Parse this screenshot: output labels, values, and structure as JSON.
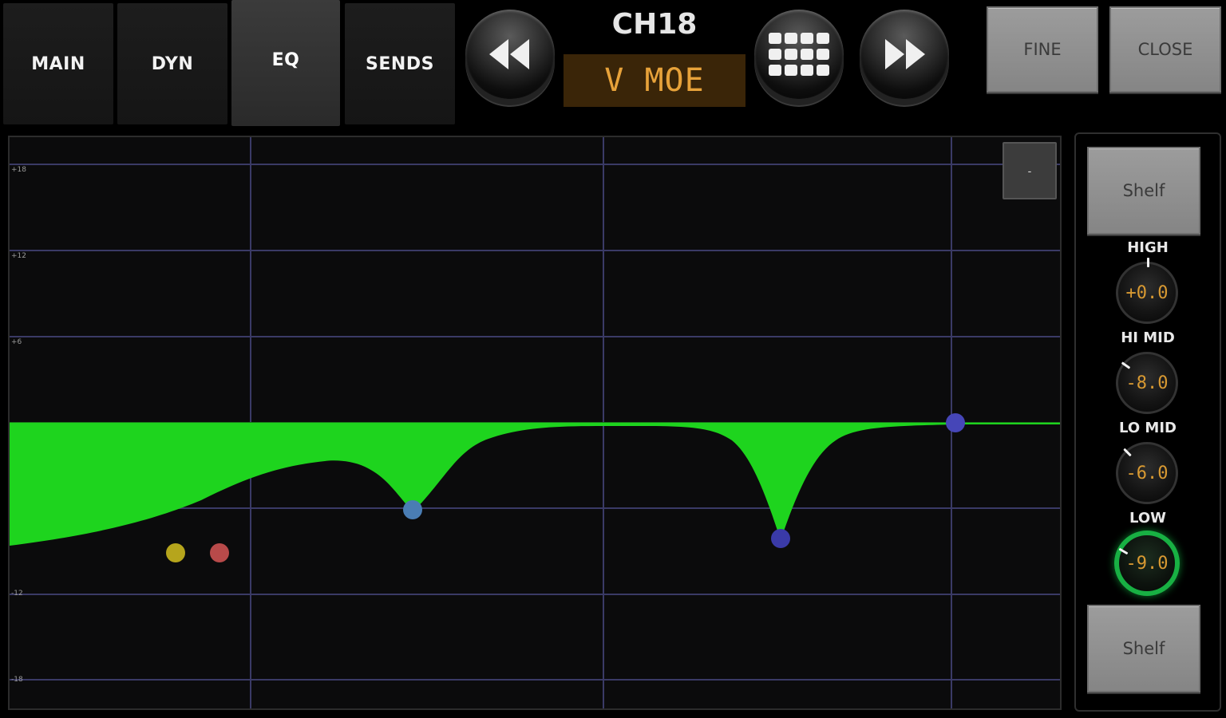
{
  "tabs": [
    {
      "label": "MAIN",
      "active": false
    },
    {
      "label": "DYN",
      "active": false
    },
    {
      "label": "EQ",
      "active": true
    },
    {
      "label": "SENDS",
      "active": false
    }
  ],
  "channel": {
    "number": "CH18",
    "name": "V MOE"
  },
  "transport": {
    "prev_icon": "rewind-icon",
    "grid_icon": "grid-icon",
    "next_icon": "fast-forward-icon"
  },
  "buttons": {
    "fine": "FINE",
    "close": "CLOSE",
    "graph_minus": "-"
  },
  "eq_graph": {
    "db_labels": [
      "+18",
      "+12",
      "+6",
      "-12",
      "-18"
    ],
    "fill_color": "#1ed41e",
    "grid_color": "#3a3a66",
    "points": [
      {
        "band": "low",
        "color": "#b6a51c"
      },
      {
        "band": "low-mid-alt",
        "color": "#b84a4a"
      },
      {
        "band": "lo-mid",
        "color": "#4a7db4"
      },
      {
        "band": "hi-mid",
        "color": "#3a3aa8"
      },
      {
        "band": "high",
        "color": "#4646b8"
      }
    ]
  },
  "side_panel": {
    "high_type": "Shelf",
    "low_type": "Shelf",
    "bands": [
      {
        "label": "HIGH",
        "value": "+0.0",
        "active": false
      },
      {
        "label": "HI MID",
        "value": "-8.0",
        "active": false
      },
      {
        "label": "LO MID",
        "value": "-6.0",
        "active": false
      },
      {
        "label": "LOW",
        "value": "-9.0",
        "active": true
      }
    ]
  }
}
